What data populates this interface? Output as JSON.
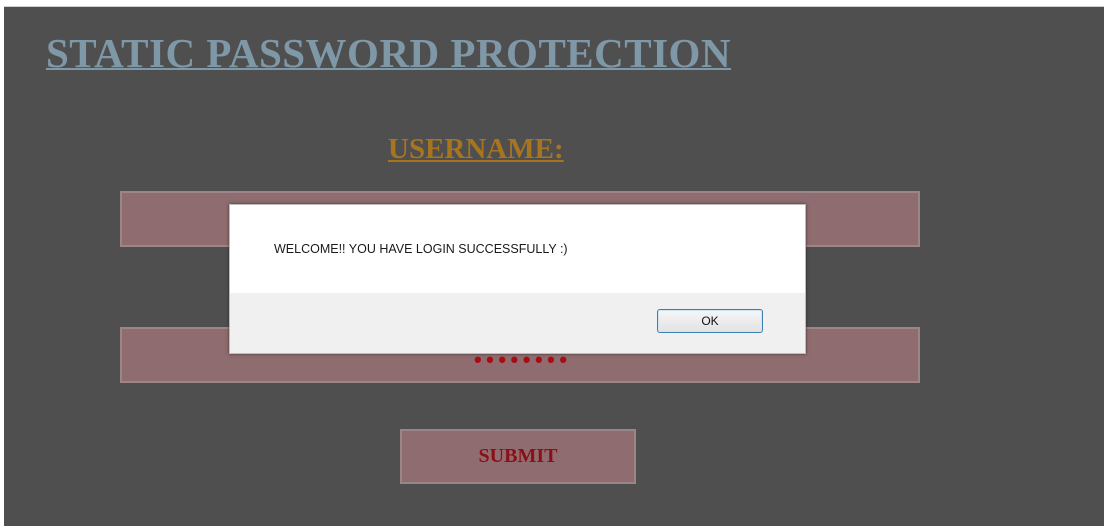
{
  "page": {
    "title": "STATIC PASSWORD PROTECTION",
    "username_label": "USERNAME:",
    "username_value": "",
    "password_value": "••••••••",
    "submit_label": "SUBMIT"
  },
  "dialog": {
    "message": "WELCOME!! YOU HAVE LOGIN SUCCESSFULLY :)",
    "ok_label": "OK"
  },
  "colors": {
    "background": "#4f4f4f",
    "title": "#7f98a8",
    "label": "#a87420",
    "field": "#8e6c6f",
    "accent_text": "#8c0f15"
  }
}
